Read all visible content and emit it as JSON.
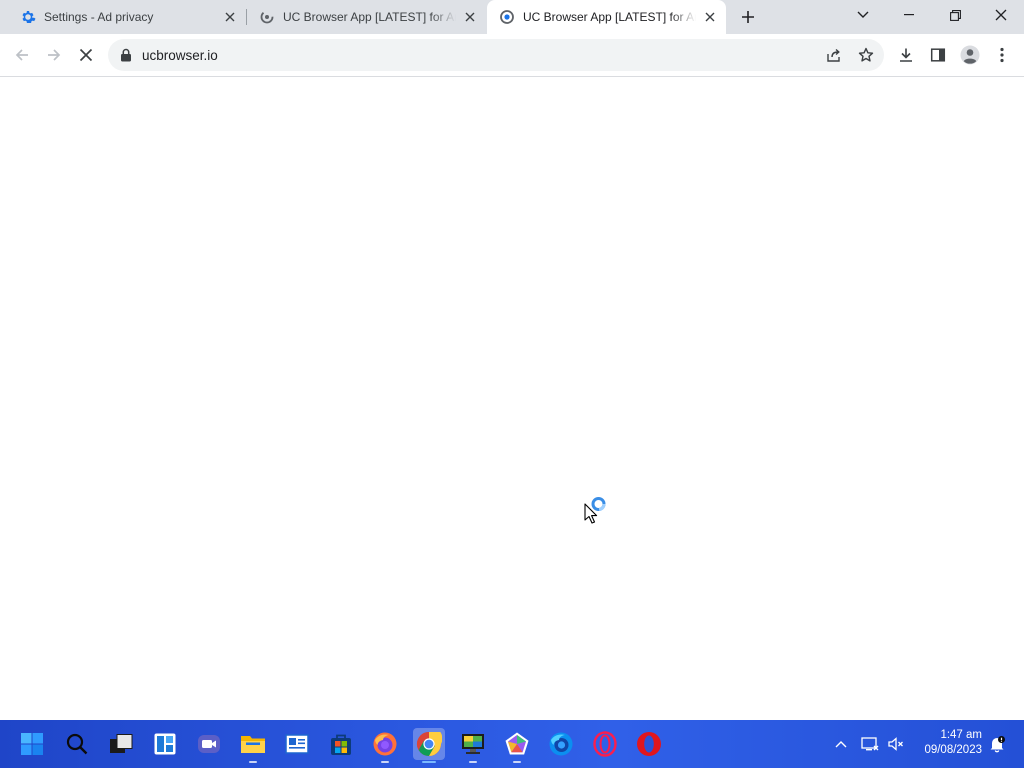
{
  "browser": {
    "tabs": [
      {
        "title": "Settings - Ad privacy",
        "icon": "gear-icon",
        "active": false
      },
      {
        "title": "UC Browser App [LATEST] for Android",
        "icon": "loading-icon",
        "active": false
      },
      {
        "title": "UC Browser App [LATEST] for Android",
        "icon": "uc-favicon-icon",
        "active": true
      }
    ],
    "address_bar": {
      "url": "ucbrowser.io"
    }
  },
  "taskbar": {
    "pinned_apps": [
      "start",
      "search",
      "task-view",
      "widgets",
      "chat",
      "file-explorer",
      "news",
      "store",
      "firefox",
      "chrome",
      "display-settings",
      "app-polygon",
      "firefox-developer",
      "opera-gx",
      "opera"
    ],
    "active_app": "chrome",
    "clock": {
      "time": "1:47 am",
      "date": "09/08/2023"
    }
  },
  "colors": {
    "tabstrip_bg": "#dee1e6",
    "omnibox_bg": "#f1f3f4",
    "taskbar_bg": "#2b58e0",
    "settings_icon": "#1a73e8"
  }
}
